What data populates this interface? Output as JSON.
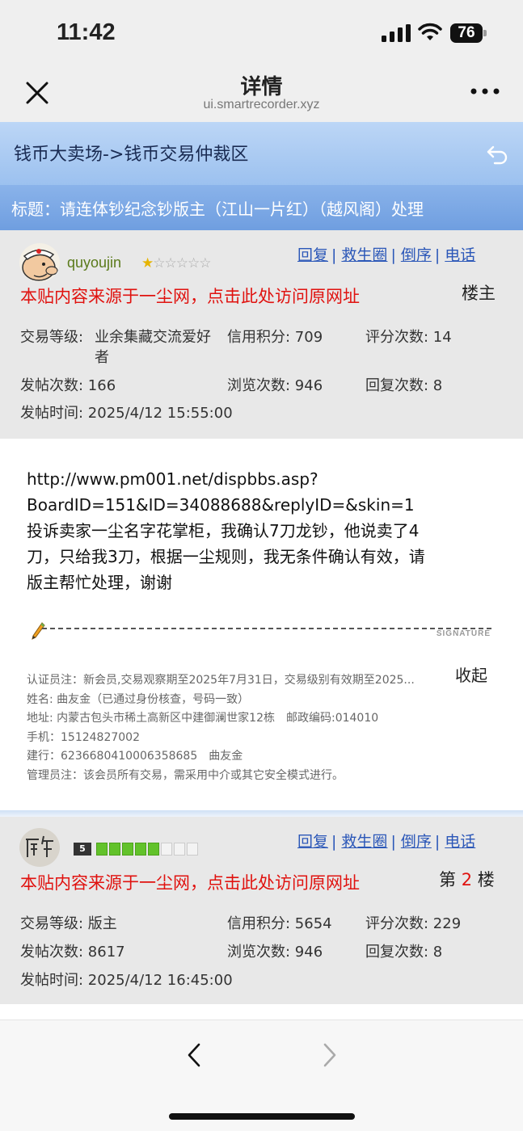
{
  "status_bar": {
    "time": "11:42",
    "battery": "76"
  },
  "nav": {
    "title": "详情",
    "url": "ui.smartrecorder.xyz"
  },
  "forum": {
    "path": "钱币大卖场->钱币交易仲裁区"
  },
  "thread": {
    "title": "标题：请连体钞纪念钞版主（江山一片红）（越风阁）处理"
  },
  "actions": [
    "回复",
    "救生圈",
    "倒序",
    "电话"
  ],
  "post1": {
    "username": "quyoujin",
    "stars_filled": 1,
    "stars_total": 5,
    "source_link": "本贴内容来源于一尘网，点击此处访问原网址",
    "floor": "楼主",
    "trade_level_label": "交易等级:",
    "trade_level_line1": "业余集藏交流爱好",
    "trade_level_line2": "者",
    "credit": "信用积分: 709",
    "rating_count": "评分次数: 14",
    "post_count": "发帖次数: 166",
    "view_count": "浏览次数: 946",
    "reply_count": "回复次数: 8",
    "post_time": "发帖时间: 2025/4/12 15:55:00",
    "body_lines": [
      "http://www.pm001.net/dispbbs.asp?",
      "BoardID=151&ID=34088688&replyID=&skin=1",
      "投诉卖家一尘名字花掌柜，我确认7刀龙钞，他说卖了4",
      "刀，只给我3刀，根据一尘规则，我无条件确认有效，请",
      "版主帮忙处理，谢谢"
    ],
    "signature_word": "SIGNATURE",
    "notes": [
      "认证员注：新会员,交易观察期至2025年7月31日，交易级别有效期至2025...",
      "姓名: 曲友金（已通过身份核查，号码一致）",
      "地址: 内蒙古包头市稀土高新区中建御澜世家12栋　邮政编码:014010",
      "手机：15124827002",
      "建行：6236680410006358685　曲友金",
      "管理员注：该会员所有交易，需采用中介或其它安全模式进行。"
    ],
    "collapse": "收起"
  },
  "post2": {
    "level_badge": "5",
    "level_filled": 5,
    "level_total": 8,
    "source_link": "本贴内容来源于一尘网，点击此处访问原网址",
    "floor_prefix": "第",
    "floor_num": "2",
    "floor_suffix": "楼",
    "trade_level": "交易等级: 版主",
    "credit": "信用积分: 5654",
    "rating_count": "评分次数: 229",
    "post_count": "发帖次数: 8617",
    "view_count": "浏览次数: 946",
    "reply_count": "回复次数: 8",
    "post_time": "发帖时间: 2025/4/12 16:45:00"
  },
  "colors": {
    "link": "#2b57b8",
    "red": "#e0120f",
    "header_blue": "#9cc1ef"
  }
}
